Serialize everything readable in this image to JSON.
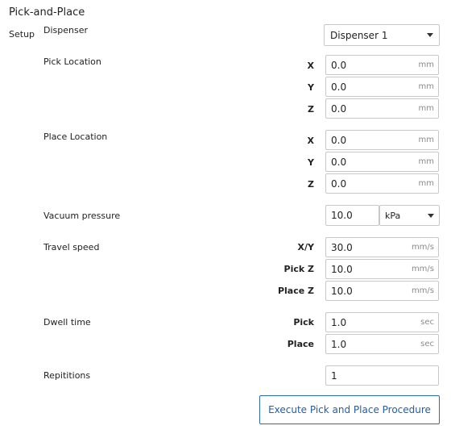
{
  "title": "Pick-and-Place",
  "tab": "Setup",
  "dispenser": {
    "label": "Dispenser",
    "selected": "Dispenser 1"
  },
  "pick_location": {
    "label": "Pick Location",
    "x_label": "X",
    "x_value": "0.0",
    "x_unit": "mm",
    "y_label": "Y",
    "y_value": "0.0",
    "y_unit": "mm",
    "z_label": "Z",
    "z_value": "0.0",
    "z_unit": "mm"
  },
  "place_location": {
    "label": "Place Location",
    "x_label": "X",
    "x_value": "0.0",
    "x_unit": "mm",
    "y_label": "Y",
    "y_value": "0.0",
    "y_unit": "mm",
    "z_label": "Z",
    "z_value": "0.0",
    "z_unit": "mm"
  },
  "vacuum": {
    "label": "Vacuum pressure",
    "value": "10.0",
    "unit": "kPa"
  },
  "travel_speed": {
    "label": "Travel speed",
    "xy_label": "X/Y",
    "xy_value": "30.0",
    "xy_unit": "mm/s",
    "pickz_label": "Pick Z",
    "pickz_value": "10.0",
    "pickz_unit": "mm/s",
    "placez_label": "Place Z",
    "placez_value": "10.0",
    "placez_unit": "mm/s"
  },
  "dwell_time": {
    "label": "Dwell time",
    "pick_label": "Pick",
    "pick_value": "1.0",
    "pick_unit": "sec",
    "place_label": "Place",
    "place_value": "1.0",
    "place_unit": "sec"
  },
  "repetitions": {
    "label": "Repititions",
    "value": "1"
  },
  "execute_button": "Execute Pick and Place Procedure"
}
